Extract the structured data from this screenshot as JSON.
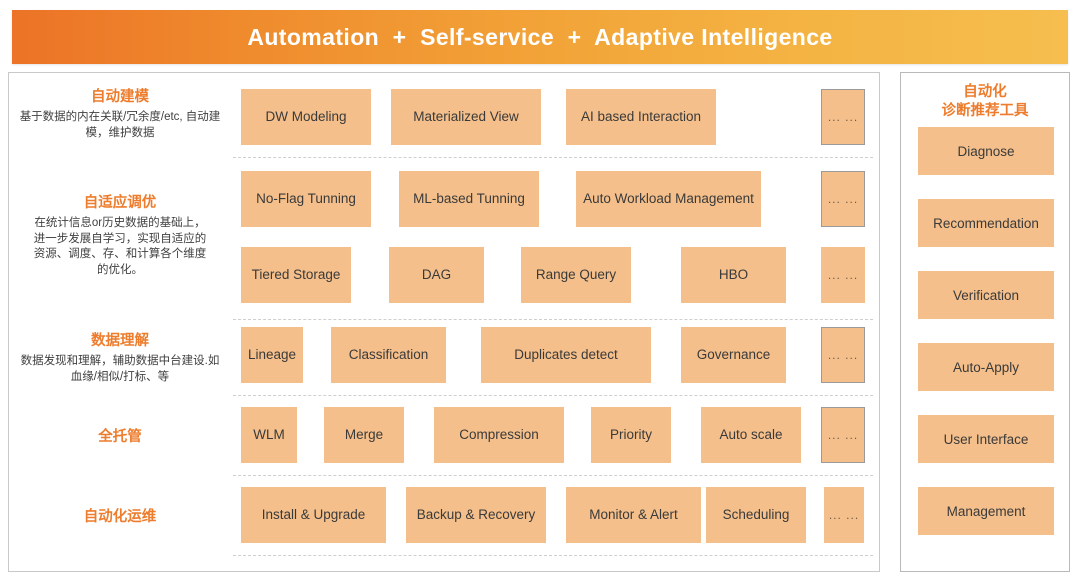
{
  "header": {
    "title": "Automation  +  Self-service  +  Adaptive Intelligence"
  },
  "left_labels": [
    {
      "title": "自动建模",
      "desc": "基于数据的内在关联/冗余度/etc,\n自动建模，维护数据"
    },
    {
      "title": "自适应调优",
      "desc": "在统计信息or历史数据的基础上，进一步发展自学习，实现自适应的资源、调度、存、和计算各个维度的优化。"
    },
    {
      "title": "数据理解",
      "desc": "数据发现和理解，辅助数据中台建设.如血缘/相似/打标、等"
    },
    {
      "title": "全托管",
      "desc": ""
    },
    {
      "title": "自动化运维",
      "desc": ""
    }
  ],
  "rows": [
    {
      "name": "row-auto-modeling",
      "chips": [
        {
          "label": "DW Modeling",
          "bordered": false
        },
        {
          "label": "Materialized View",
          "bordered": false
        },
        {
          "label": "AI based Interaction",
          "bordered": false
        },
        {
          "label": "... ...",
          "bordered": true
        }
      ]
    },
    {
      "name": "row-adaptive-tuning-1",
      "chips": [
        {
          "label": "No-Flag Tunning",
          "bordered": false
        },
        {
          "label": "ML-based Tunning",
          "bordered": false
        },
        {
          "label": "Auto Workload Management",
          "bordered": false
        },
        {
          "label": "... ...",
          "bordered": true
        }
      ]
    },
    {
      "name": "row-adaptive-tuning-2",
      "chips": [
        {
          "label": "Tiered Storage",
          "bordered": false
        },
        {
          "label": "DAG",
          "bordered": false
        },
        {
          "label": "Range Query",
          "bordered": false
        },
        {
          "label": "HBO",
          "bordered": false
        },
        {
          "label": "... ...",
          "bordered": false
        }
      ]
    },
    {
      "name": "row-data-understanding",
      "chips": [
        {
          "label": "Lineage",
          "bordered": false
        },
        {
          "label": "Classification",
          "bordered": false
        },
        {
          "label": "Duplicates detect",
          "bordered": false
        },
        {
          "label": "Governance",
          "bordered": false
        },
        {
          "label": "... ...",
          "bordered": true
        }
      ]
    },
    {
      "name": "row-fully-managed",
      "chips": [
        {
          "label": "WLM",
          "bordered": false
        },
        {
          "label": "Merge",
          "bordered": false
        },
        {
          "label": "Compression",
          "bordered": false
        },
        {
          "label": "Priority",
          "bordered": false
        },
        {
          "label": "Auto scale",
          "bordered": false
        },
        {
          "label": "... ...",
          "bordered": true
        }
      ]
    },
    {
      "name": "row-auto-ops",
      "chips": [
        {
          "label": "Install & Upgrade",
          "bordered": false
        },
        {
          "label": "Backup  & Recovery",
          "bordered": false
        },
        {
          "label": "Monitor & Alert",
          "bordered": false
        },
        {
          "label": "Scheduling",
          "bordered": false
        },
        {
          "label": "... ...",
          "bordered": false
        }
      ]
    }
  ],
  "right_panel": {
    "title_line1": "自动化",
    "title_line2": "诊断推荐工具",
    "items": [
      {
        "label": "Diagnose"
      },
      {
        "label": "Recommendation"
      },
      {
        "label": "Verification"
      },
      {
        "label": "Auto-Apply"
      },
      {
        "label": "User Interface"
      },
      {
        "label": "Management"
      }
    ]
  },
  "colors": {
    "accent_orange": "#ED7D2D",
    "chip_fill": "#F4BF8A",
    "banner_start": "#EC7327",
    "banner_end": "#F5BE4E",
    "frame_border": "#C9C9C9"
  }
}
